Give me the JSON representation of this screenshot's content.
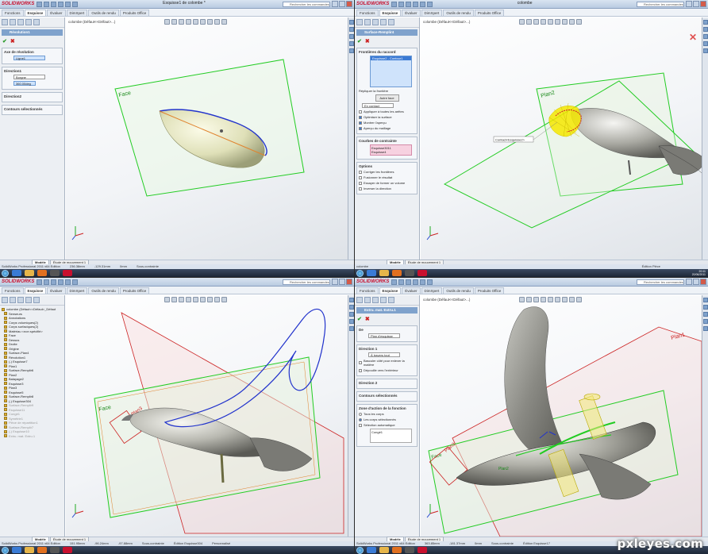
{
  "app": {
    "name": "SOLIDWORKS"
  },
  "command_tabs": [
    "Fonctions",
    "Esquisse",
    "Évaluer",
    "DimXpert",
    "Outils de rendu",
    "Produits Office"
  ],
  "bottom_tabs": [
    "Modèle",
    "Étude de mouvement 1"
  ],
  "search_placeholder": "Rechercher les commandes",
  "q1": {
    "window_title": "Esquisse1 de colombe *",
    "doc_label": "colombe (Défaut<<Défaut>...)",
    "pm_title": "Révolution1",
    "group1_title": "Axe de révolution",
    "axis_value": "Ligne1",
    "group2_title": "Direction1",
    "dir_type": "Borgne",
    "dir_angle": "360.00deg",
    "group3_title": "Direction2",
    "group4_title": "Contours sélectionnés",
    "plane_label": "Face",
    "status": [
      "SolidWorks Professional 2011 x64 Edition",
      "236.38mm",
      "-129.31mm",
      "0mm",
      "Sous-contrainte"
    ]
  },
  "q2": {
    "window_title": "colombe",
    "doc_label": "colombe (Défaut<<Défaut>...)",
    "pm_title": "Surface-Remplir4",
    "group1_title": "Frontières du raccord",
    "list_item": "Esquisse2 - Contour1",
    "link_label": "Répliquer la frontière",
    "alt_button": "Autre face",
    "contact_value": "En contact",
    "opt1": "Appliquer à toutes les arêtes",
    "opt2": "Optimiser la surface",
    "opt3": "Montrer l'aperçu",
    "opt4": "Aperçu du maillage",
    "group2_title": "Courbes de contrainte",
    "constraint_items": [
      "Esquisse3011",
      "Esquisse4"
    ],
    "group3_title": "Options",
    "opt5": "Corriger les frontières",
    "opt6": "Fusionner le résultat",
    "opt7": "Essayer de former un volume",
    "opt8": "Inverser la direction",
    "callout": "Contact<Esquisse2>",
    "plane_label": "Plan2",
    "status_right": "Édition Pièce"
  },
  "q3": {
    "doc_label": "colombe (Défaut<<Défaut>_Défaut",
    "tree": [
      "Senseurs",
      "Annotations",
      "Corps volumiques(2)",
      "Corps surfaciques(2)",
      "Matériau <non spécifié>",
      "Face",
      "Dessus",
      "Droite",
      "Origine",
      "Surface-Plan4",
      "Révolution1",
      "(-) Esquisse7",
      "Plan1",
      "Surface-Remplir6",
      "Plan2",
      "Balayage2",
      "Esquisse3",
      "Plan3",
      "Esquisse5",
      "Surface-Remplir8",
      "(-) Esquisse304"
    ],
    "tree_grey": [
      "Surface-Remplir9",
      "Esquisse11",
      "Congé1",
      "Symétrie1",
      "Pièce de répartition1",
      "Surface-Remplir7",
      "(-) Esquisse10",
      "Extru. mat. Extru.1"
    ],
    "labels": [
      "Face",
      "Plan3"
    ],
    "status": [
      "SolidWorks Professional 2011 x64 Edition",
      "151.95mm",
      "-96.24mm",
      "-97.88mm",
      "Sous-contrainte",
      "Édition Esquisse304",
      "Personnalisé"
    ]
  },
  "q4": {
    "doc_label": "colombe (Défaut<<Défaut>...)",
    "pm_title": "Extru. mat. Extru.1",
    "group1_title": "De",
    "from_value": "Plan d'esquisse",
    "group2_title": "Direction 1",
    "dir_value": "À travers tout",
    "opt1": "Basculer côté pour enlever la matière",
    "opt2": "Dépouille vers l'extérieur",
    "group3_title": "Direction 2",
    "group4_title": "Contours sélectionnés",
    "group5_title": "Zone d'action de la fonction",
    "radio1": "Tous les corps",
    "radio2": "Les corps sélectionnés",
    "opt3": "Sélection automatique",
    "body_item": "Congé1",
    "labels": [
      "Plan1",
      "Face",
      "Plan3",
      "Plan2"
    ],
    "status": [
      "SolidWorks Professional 2011 x64 Edition",
      "363.85mm",
      "-181.37mm",
      "0mm",
      "Sous-contrainte",
      "Édition Esquisse17"
    ]
  },
  "clock": {
    "time": "20:11",
    "date": "20/06/2011"
  },
  "watermark": "pxleyes.com",
  "colors": {
    "titlebar": "#c8d6e8",
    "sketch_blue": "#2233cc",
    "plane_green": "#33cc33",
    "plane_red": "#cc2222",
    "body": "#8a8a80"
  }
}
